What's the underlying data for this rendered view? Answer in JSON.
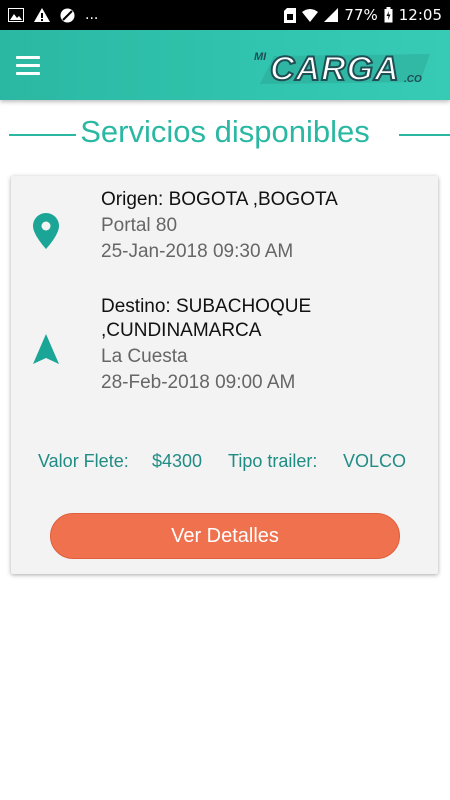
{
  "status_bar": {
    "ellipsis": "...",
    "battery": "77%",
    "time": "12:05",
    "icons": [
      "image-icon",
      "warning-icon",
      "no-entry-icon",
      "sim-icon",
      "wifi-icon",
      "signal-icon",
      "battery-icon"
    ]
  },
  "app_bar": {
    "logo_small": "MI",
    "logo_main": "CARGA",
    "logo_suffix": ".CO",
    "colors": {
      "bar": "#2bb8a3",
      "logo_dark": "#1f4f55",
      "logo_light": "#ffffff"
    }
  },
  "page": {
    "title": "Servicios disponibles",
    "accent": "#2bb8a3"
  },
  "service": {
    "origin": {
      "line1": "Origen: BOGOTA ,BOGOTA",
      "place": "Portal 80",
      "datetime": "25-Jan-2018 09:30 AM",
      "icon": "location-pin-icon"
    },
    "destination": {
      "line1": "Destino: SUBACHOQUE",
      "line2": ",CUNDINAMARCA",
      "place": "La Cuesta",
      "datetime": "28-Feb-2018 09:00 AM",
      "icon": "navigation-arrow-icon"
    },
    "freight_label": "Valor Flete:",
    "freight_value": "$4300",
    "trailer_label": "Tipo trailer:",
    "trailer_value": "VOLCO",
    "details_button": "Ver Detalles",
    "button_color": "#f0714d"
  }
}
